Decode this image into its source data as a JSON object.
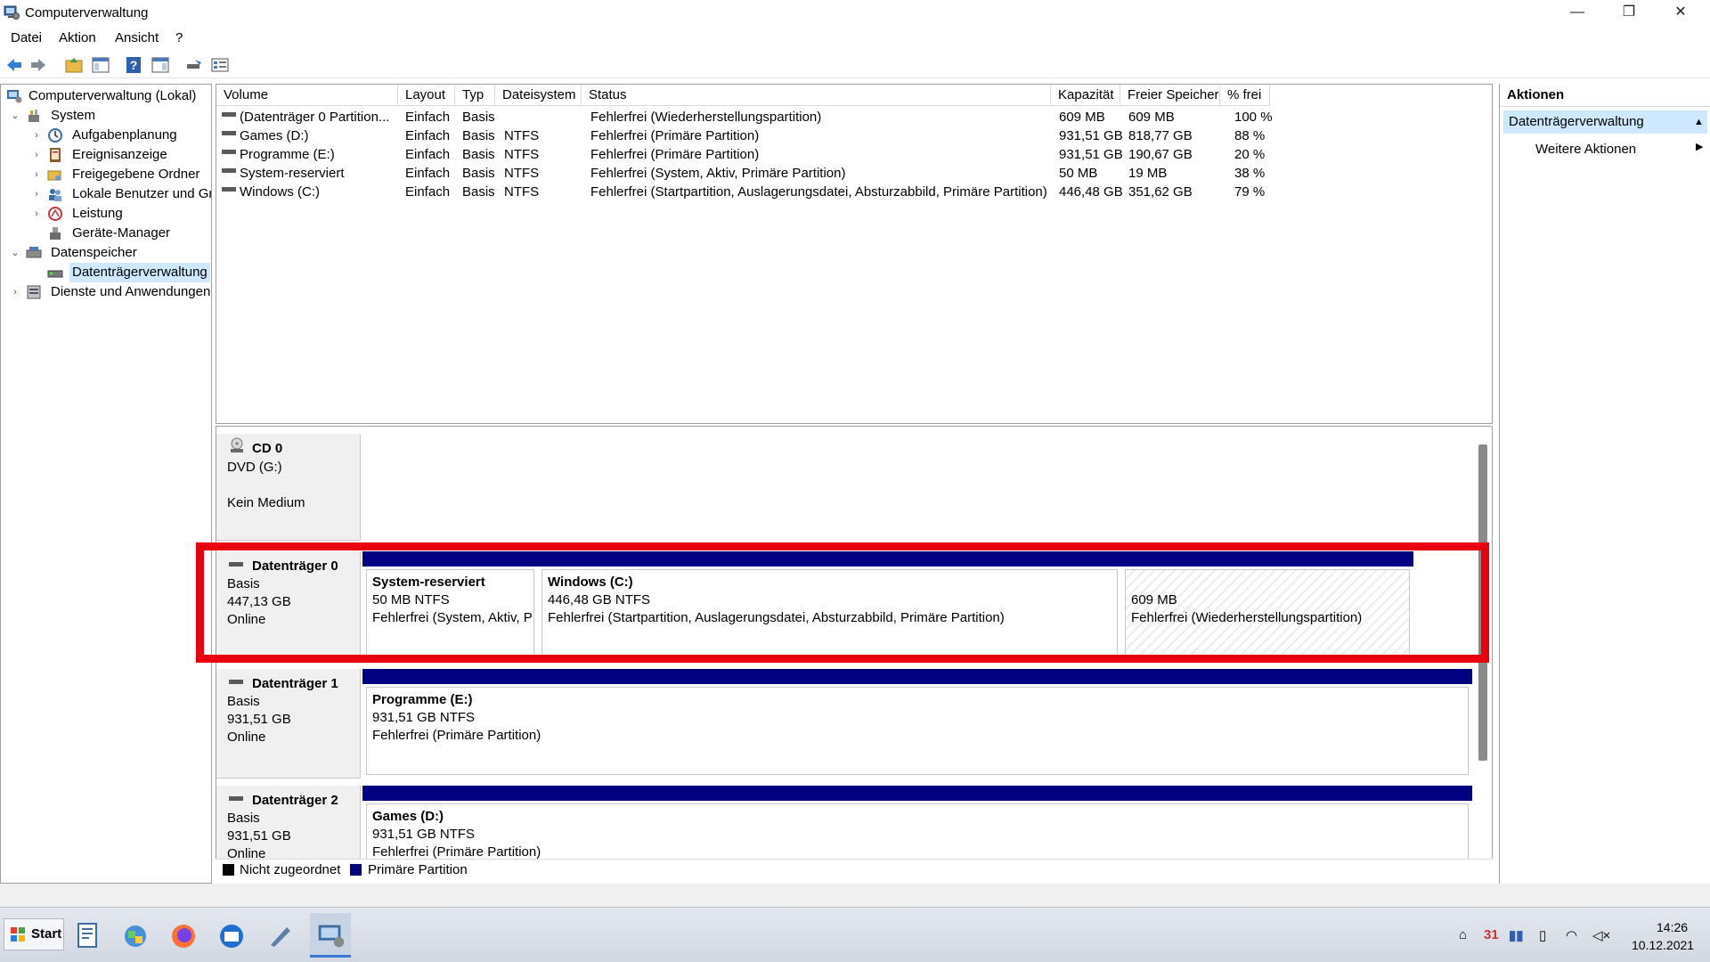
{
  "window": {
    "title": "Computerverwaltung",
    "minimize": "—",
    "restore": "❐",
    "close": "✕"
  },
  "menu": [
    "Datei",
    "Aktion",
    "Ansicht",
    "?"
  ],
  "tree": {
    "root": "Computerverwaltung (Lokal)",
    "system": "System",
    "aufgaben": "Aufgabenplanung",
    "ereignis": "Ereignisanzeige",
    "freigabe": "Freigegebene Ordner",
    "benutzer": "Lokale Benutzer und Gr",
    "leistung": "Leistung",
    "geraete": "Geräte-Manager",
    "datenspeicher": "Datenspeicher",
    "dtv": "Datenträgerverwaltung",
    "dienste": "Dienste und Anwendungen"
  },
  "volume_table": {
    "headers": [
      "Volume",
      "Layout",
      "Typ",
      "Dateisystem",
      "Status",
      "Kapazität",
      "Freier Speicher",
      "% frei"
    ],
    "rows": [
      [
        "(Datenträger 0 Partition...",
        "Einfach",
        "Basis",
        "",
        "Fehlerfrei (Wiederherstellungspartition)",
        "609 MB",
        "609 MB",
        "100 %"
      ],
      [
        "Games (D:)",
        "Einfach",
        "Basis",
        "NTFS",
        "Fehlerfrei (Primäre Partition)",
        "931,51 GB",
        "818,77 GB",
        "88 %"
      ],
      [
        "Programme (E:)",
        "Einfach",
        "Basis",
        "NTFS",
        "Fehlerfrei (Primäre Partition)",
        "931,51 GB",
        "190,67 GB",
        "20 %"
      ],
      [
        "System-reserviert",
        "Einfach",
        "Basis",
        "NTFS",
        "Fehlerfrei (System, Aktiv, Primäre Partition)",
        "50 MB",
        "19 MB",
        "38 %"
      ],
      [
        "Windows (C:)",
        "Einfach",
        "Basis",
        "NTFS",
        "Fehlerfrei (Startpartition, Auslagerungsdatei, Absturzabbild, Primäre Partition)",
        "446,48 GB",
        "351,62 GB",
        "79 %"
      ]
    ]
  },
  "disks": {
    "cd0": {
      "name": "CD 0",
      "l1": "DVD (G:)",
      "l2": "Kein Medium"
    },
    "d0": {
      "name": "Datenträger 0",
      "type": "Basis",
      "size": "447,13 GB",
      "state": "Online",
      "p1": {
        "name": "System-reserviert",
        "size": "50 MB NTFS",
        "status": "Fehlerfrei (System, Aktiv, P"
      },
      "p2": {
        "name": "Windows  (C:)",
        "size": "446,48 GB NTFS",
        "status": "Fehlerfrei (Startpartition, Auslagerungsdatei, Absturzabbild, Primäre Partition)"
      },
      "p3": {
        "size": "609 MB",
        "status": "Fehlerfrei (Wiederherstellungspartition)"
      }
    },
    "d1": {
      "name": "Datenträger 1",
      "type": "Basis",
      "size": "931,51 GB",
      "state": "Online",
      "p1": {
        "name": "Programme  (E:)",
        "size": "931,51 GB NTFS",
        "status": "Fehlerfrei (Primäre Partition)"
      }
    },
    "d2": {
      "name": "Datenträger 2",
      "type": "Basis",
      "size": "931,51 GB",
      "state": "Online",
      "p1": {
        "name": "Games  (D:)",
        "size": "931,51 GB NTFS",
        "status": "Fehlerfrei (Primäre Partition)"
      }
    }
  },
  "legend": {
    "unallocated": "Nicht zugeordnet",
    "primary": "Primäre Partition"
  },
  "actions": {
    "header": "Aktionen",
    "section": "Datenträgerverwaltung",
    "more": "Weitere Aktionen"
  },
  "taskbar": {
    "start": "Start",
    "time": "14:26",
    "date": "10.12.2021"
  },
  "colors": {
    "primary_partition": "#000080",
    "highlight": "#e8000e",
    "selection": "#cde8ff"
  }
}
